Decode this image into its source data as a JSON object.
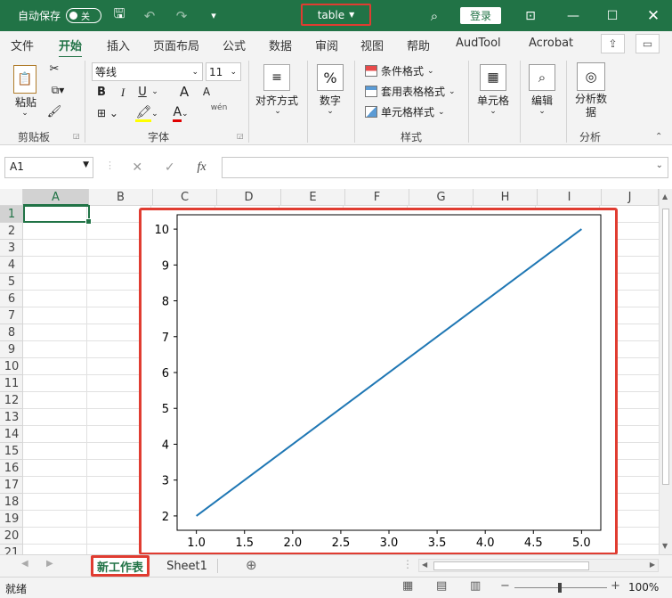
{
  "titlebar": {
    "autosave_label": "自动保存",
    "toggle_state": "关",
    "file_title": "table",
    "signin_label": "登录"
  },
  "menu_tabs": [
    "文件",
    "开始",
    "插入",
    "页面布局",
    "公式",
    "数据",
    "审阅",
    "视图",
    "帮助",
    "AudTool",
    "Acrobat"
  ],
  "ribbon": {
    "clipboard": {
      "paste": "粘贴",
      "group": "剪贴板"
    },
    "font": {
      "name": "等线",
      "size": "11",
      "bold": "B",
      "italic": "I",
      "underline": "U",
      "grow": "A",
      "shrink": "A",
      "phonetic": "wén",
      "group": "字体"
    },
    "alignment": {
      "label": "对齐方式"
    },
    "number": {
      "label": "数字",
      "icon_text": "%"
    },
    "styles": {
      "conditional": "条件格式",
      "table": "套用表格格式",
      "cell": "单元格样式",
      "group": "样式"
    },
    "cells": {
      "label": "单元格"
    },
    "editing": {
      "label": "编辑"
    },
    "analysis": {
      "label": "分析数据",
      "group": "分析"
    }
  },
  "formula_bar": {
    "name_box": "A1",
    "formula": "",
    "fx": "fx"
  },
  "columns": [
    "A",
    "B",
    "C",
    "D",
    "E",
    "F",
    "G",
    "H",
    "I",
    "J"
  ],
  "rows": [
    "1",
    "2",
    "3",
    "4",
    "5",
    "6",
    "7",
    "8",
    "9",
    "10",
    "11",
    "12",
    "13",
    "14",
    "15",
    "16",
    "17",
    "18",
    "19",
    "20",
    "21"
  ],
  "sheet_tabs": {
    "active": "新工作表",
    "other": "Sheet1"
  },
  "statusbar": {
    "ready": "就绪",
    "zoom": "100%"
  },
  "colors": {
    "excel_green": "#217346",
    "highlight_red": "#e03c31",
    "line_blue": "#1f77b4"
  },
  "chart_data": {
    "type": "line",
    "x": [
      1.0,
      5.0
    ],
    "series": [
      {
        "values": [
          2,
          10
        ]
      }
    ],
    "xlim": [
      0.8,
      5.2
    ],
    "ylim": [
      1.6,
      10.4
    ],
    "xticks": [
      "1.0",
      "1.5",
      "2.0",
      "2.5",
      "3.0",
      "3.5",
      "4.0",
      "4.5",
      "5.0"
    ],
    "yticks": [
      "2",
      "3",
      "4",
      "5",
      "6",
      "7",
      "8",
      "9",
      "10"
    ],
    "grid": false,
    "title": "",
    "xlabel": "",
    "ylabel": ""
  }
}
